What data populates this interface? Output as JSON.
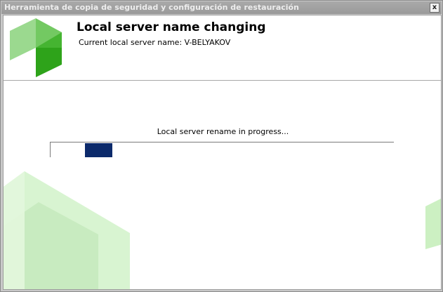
{
  "window": {
    "title": "Herramienta de copia de seguridad y configuración de restauración",
    "close_label": "x"
  },
  "header": {
    "title": "Local server name changing",
    "subtitle": "Current local server name: V-BELYAKOV"
  },
  "main": {
    "status_text": "Local server rename in progress..."
  },
  "progress": {
    "chunk_start_fraction": 0.1,
    "chunk_end_fraction": 0.18
  },
  "colors": {
    "logo_light": "#9bd98f",
    "logo_mid": "#73c962",
    "logo_dark": "#2ea31a",
    "progress_fill": "#0c2a6b",
    "decor_green": "#c9efbf"
  }
}
